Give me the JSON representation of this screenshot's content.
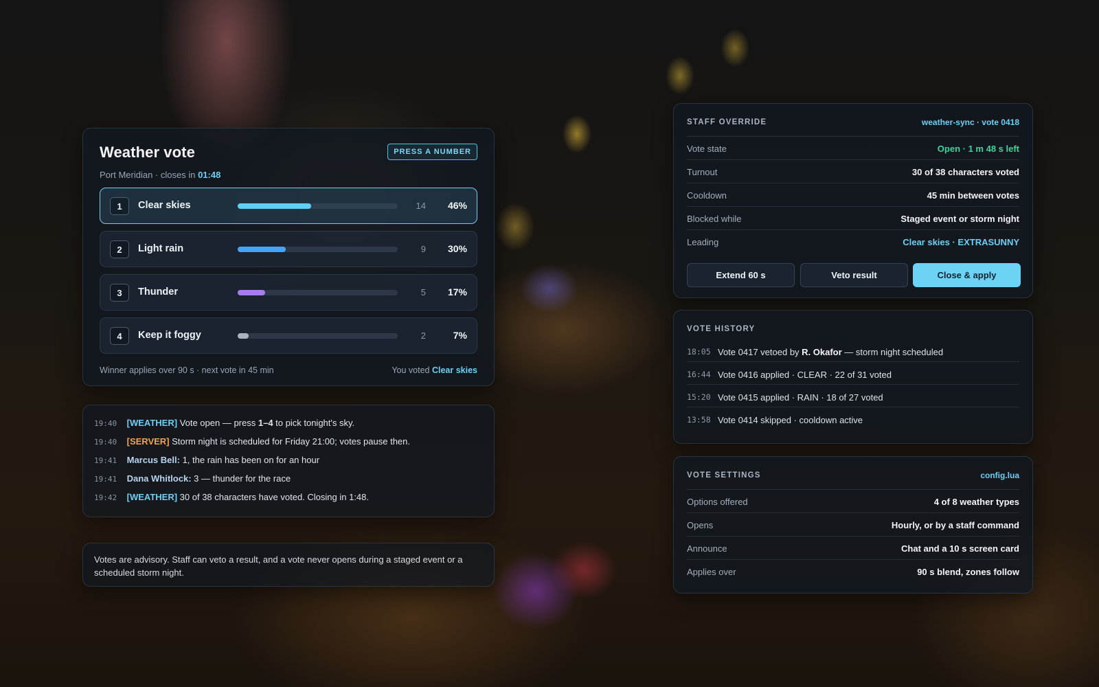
{
  "vote": {
    "title": "Weather vote",
    "badge": "PRESS A NUMBER",
    "subtitle": "Port Meridian · closes in",
    "closes_in": "01:48",
    "options": [
      {
        "key": "1",
        "label": "Clear skies",
        "count": "14",
        "pct": "46%",
        "fraction": 0.46,
        "color": "#5fd0f3",
        "selected": true
      },
      {
        "key": "2",
        "label": "Light rain",
        "count": "9",
        "pct": "30%",
        "fraction": 0.3,
        "color": "#4aa3f2",
        "selected": false
      },
      {
        "key": "3",
        "label": "Thunder",
        "count": "5",
        "pct": "17%",
        "fraction": 0.17,
        "color": "#a77cf2",
        "selected": false
      },
      {
        "key": "4",
        "label": "Keep it foggy",
        "count": "2",
        "pct": "7%",
        "fraction": 0.07,
        "color": "#aab4bf",
        "selected": false
      }
    ],
    "footer_left": "Winner applies over 90 s · next vote in 45 min",
    "footer_right_prefix": "You voted",
    "footer_right_choice": "Clear skies"
  },
  "chat": {
    "lines": [
      {
        "time": "19:40",
        "tag": "[WEATHER]",
        "tag_type": "weather",
        "pre": "Vote open — press ",
        "bold": "1–4",
        "post": " to pick tonight's sky."
      },
      {
        "time": "19:40",
        "tag": "[SERVER]",
        "tag_type": "server",
        "pre": "Storm night is scheduled for Friday 21:00; votes pause then.",
        "bold": "",
        "post": ""
      },
      {
        "time": "19:41",
        "name": "Marcus Bell:",
        "pre": "1, the rain has been on for an hour",
        "bold": "",
        "post": ""
      },
      {
        "time": "19:41",
        "name": "Dana Whitlock:",
        "pre": "3 — thunder for the race",
        "bold": "",
        "post": ""
      },
      {
        "time": "19:42",
        "tag": "[WEATHER]",
        "tag_type": "weather",
        "pre": "30 of 38 characters have voted. Closing in 1:48.",
        "bold": "",
        "post": ""
      }
    ]
  },
  "note": {
    "text": "Votes are advisory. Staff can veto a result, and a vote never opens during a staged event or a scheduled storm night."
  },
  "staff": {
    "title": "STAFF OVERRIDE",
    "meta": "weather-sync · vote 0418",
    "rows": [
      {
        "k": "Vote state",
        "v": "Open · 1 m 48 s left",
        "style": "green"
      },
      {
        "k": "Turnout",
        "v": "30 of 38 characters voted",
        "style": ""
      },
      {
        "k": "Cooldown",
        "v": "45 min between votes",
        "style": ""
      },
      {
        "k": "Blocked while",
        "v": "Staged event or storm night",
        "style": ""
      },
      {
        "k": "Leading",
        "v": "Clear skies · EXTRASUNNY",
        "style": "blue"
      }
    ],
    "buttons": {
      "extend": "Extend 60 s",
      "veto": "Veto result",
      "apply": "Close & apply"
    }
  },
  "history": {
    "title": "VOTE HISTORY",
    "rows": [
      {
        "time": "18:05",
        "pre": "Vote 0417 vetoed by ",
        "bold": "R. Okafor",
        "post": " — storm night scheduled"
      },
      {
        "time": "16:44",
        "pre": "Vote 0416 applied · CLEAR · 22 of 31 voted",
        "bold": "",
        "post": ""
      },
      {
        "time": "15:20",
        "pre": "Vote 0415 applied · RAIN · 18 of 27 voted",
        "bold": "",
        "post": ""
      },
      {
        "time": "13:58",
        "pre": "Vote 0414 skipped · cooldown active",
        "bold": "",
        "post": ""
      }
    ]
  },
  "settings": {
    "title": "VOTE SETTINGS",
    "meta": "config.lua",
    "rows": [
      {
        "k": "Options offered",
        "v": "4 of 8 weather types"
      },
      {
        "k": "Opens",
        "v": "Hourly, or by a staff command"
      },
      {
        "k": "Announce",
        "v": "Chat and a 10 s screen card"
      },
      {
        "k": "Applies over",
        "v": "90 s blend, zones follow"
      }
    ]
  }
}
